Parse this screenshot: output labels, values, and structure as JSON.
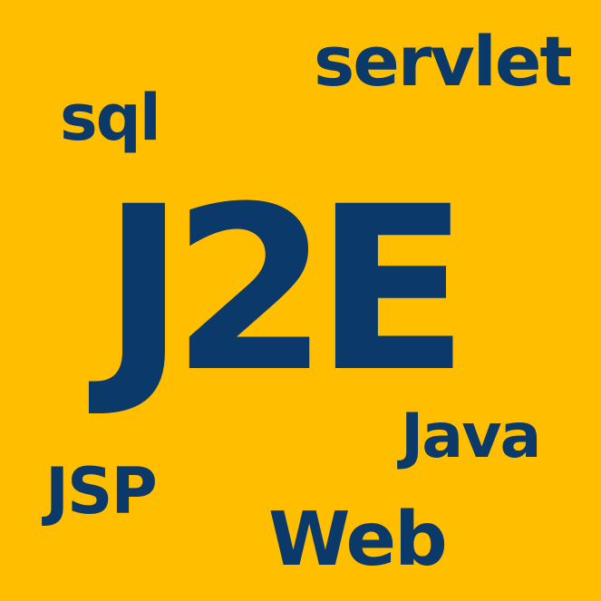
{
  "colors": {
    "background": "#ffbe00",
    "text": "#0b3a6a"
  },
  "words": {
    "servlet": "servlet",
    "sql": "sql",
    "main": "J2E",
    "java": "Java",
    "jsp": "JSP",
    "web": "Web"
  }
}
